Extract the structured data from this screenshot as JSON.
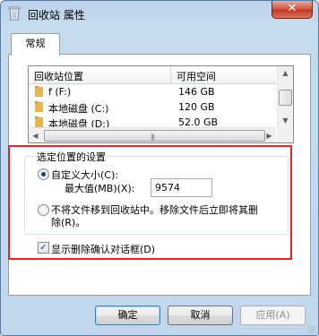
{
  "window": {
    "title": "回收站 属性",
    "close_label": "✕",
    "icon": "recycle-bin-icon"
  },
  "tabs": [
    {
      "label": "常规",
      "selected": true
    }
  ],
  "locations": {
    "columns": [
      "回收站位置",
      "可用空间"
    ],
    "rows": [
      {
        "name": "f (F:)",
        "free": "146 GB"
      },
      {
        "name": "本地磁盘 (C:)",
        "free": "120 GB"
      },
      {
        "name": "本地磁盘 (D:)",
        "free": "52.0 GB"
      }
    ]
  },
  "settings": {
    "group_title": "选定位置的设置",
    "custom_size": {
      "label": "自定义大小(C):",
      "selected": true
    },
    "max_size": {
      "label": "最大值(MB)(X):",
      "value": "9574"
    },
    "no_move": {
      "label_line1": "不将文件移到回收站中。移除文件后立即将其删",
      "label_line2": "除(R)。",
      "selected": false
    },
    "confirm_delete": {
      "label": "显示删除确认对话框(D)",
      "checked": true
    }
  },
  "buttons": {
    "ok": "确定",
    "cancel": "取消",
    "apply": "应用(A)"
  },
  "colors": {
    "highlight_frame": "#e8232a",
    "title_bg": "#bcd3ea"
  }
}
